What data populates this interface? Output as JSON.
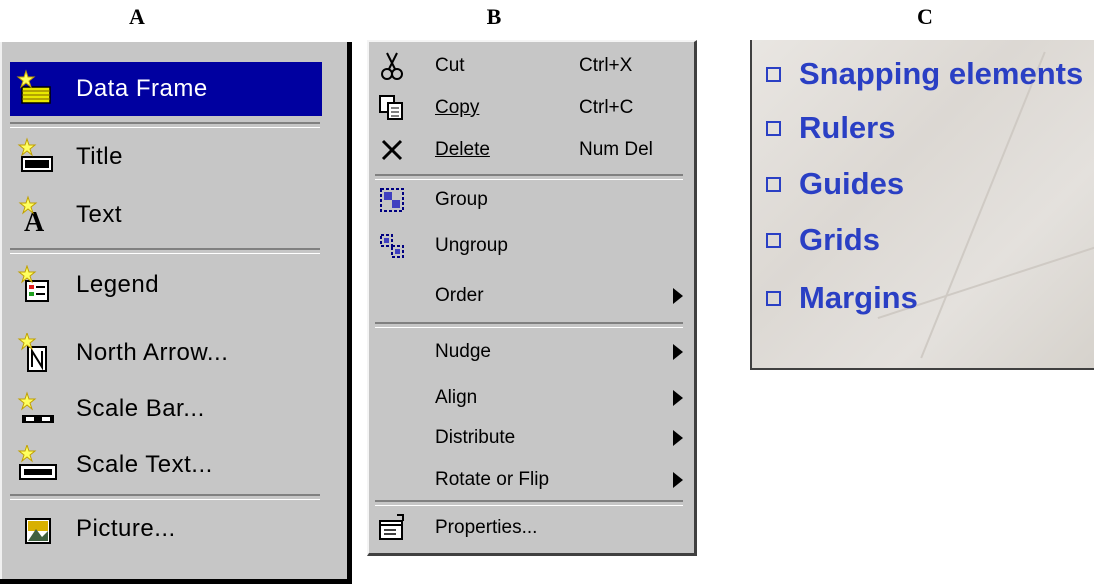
{
  "labels": {
    "a": "A",
    "b": "B",
    "c": "C"
  },
  "menu_a": {
    "items": [
      {
        "label": "Data Frame",
        "icon": "data-frame-icon",
        "selected": true
      },
      {
        "label": "Title",
        "icon": "title-icon"
      },
      {
        "label": "Text",
        "icon": "text-icon"
      },
      {
        "label": "Legend",
        "icon": "legend-icon"
      },
      {
        "label": "North Arrow...",
        "icon": "north-arrow-icon"
      },
      {
        "label": "Scale Bar...",
        "icon": "scale-bar-icon"
      },
      {
        "label": "Scale Text...",
        "icon": "scale-text-icon"
      },
      {
        "label": "Picture...",
        "icon": "picture-icon"
      }
    ]
  },
  "menu_b": {
    "cut": {
      "label": "Cut",
      "shortcut": "Ctrl+X"
    },
    "copy": {
      "label": "Copy",
      "shortcut": "Ctrl+C"
    },
    "delete": {
      "label": "Delete",
      "shortcut": "Num Del"
    },
    "group": {
      "label": "Group"
    },
    "ungroup": {
      "label": "Ungroup"
    },
    "order": {
      "label": "Order"
    },
    "nudge": {
      "label": "Nudge"
    },
    "align": {
      "label": "Align"
    },
    "distribute": {
      "label": "Distribute"
    },
    "rotate": {
      "label": "Rotate or Flip"
    },
    "properties": {
      "label": "Properties..."
    }
  },
  "panel_c": {
    "items": [
      "Snapping elements",
      "Rulers",
      "Guides",
      "Grids",
      "Margins"
    ],
    "text_color": "#2a3fc4"
  }
}
